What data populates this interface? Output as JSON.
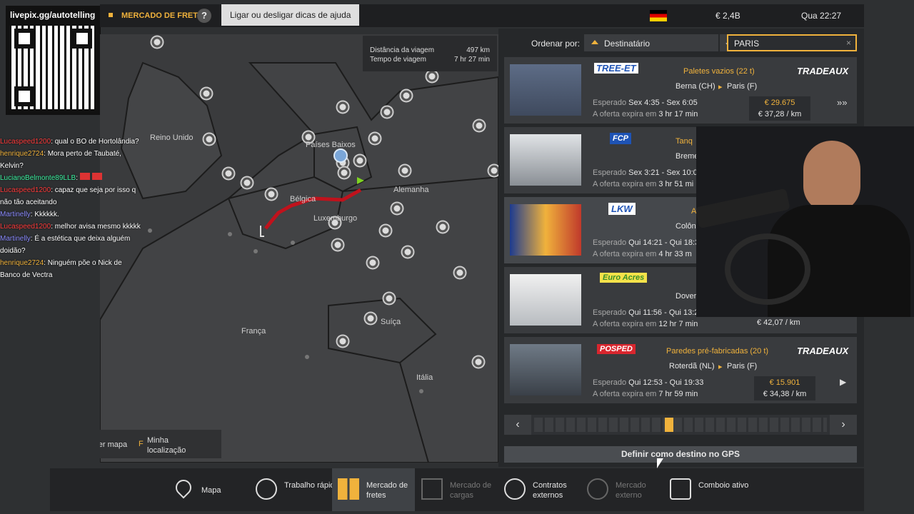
{
  "stream": {
    "livepix_url": "livepix.gg/autotelling"
  },
  "top": {
    "breadcrumb": "MERCADO DE FRETES",
    "help": "?",
    "tooltip": "Ligar ou desligar dicas de ajuda",
    "money": "€ 2,4B",
    "time": "Qua 22:27",
    "flag_colors": [
      "#000000",
      "#dd0000",
      "#ffce00"
    ]
  },
  "map": {
    "info": {
      "distance_label": "Distância da viagem",
      "distance_value": "497 km",
      "time_label": "Tempo de viagem",
      "time_value": "7 hr 27 min"
    },
    "countries": [
      "Reino Unido",
      "Países Baixos",
      "Bélgica",
      "Alemanha",
      "Luxemburgo",
      "França",
      "Suíça",
      "Itália"
    ],
    "controls": {
      "move_map": "Mover mapa",
      "my_location_key": "F",
      "my_location": "Minha localização"
    },
    "route_color": "#c0121c"
  },
  "panel": {
    "sort_label": "Ordenar por:",
    "sort_value": "Destinatário",
    "search_value": "PARIS",
    "jobs": [
      {
        "company": "TREE-ET",
        "cargo": "Paletes vazios (22 t)",
        "origin": "Berna (CH)",
        "dest": "Paris (F)",
        "expected_label": "Esperado",
        "expected": "Sex 4:35 - Sex 6:05",
        "expires_label": "A oferta expira em",
        "expires": "3 hr 17 min",
        "price": "€ 29.675",
        "per_km": "€ 37,28 / km",
        "client": "TRADEAUX"
      },
      {
        "company": "FCP",
        "cargo": "Tanq",
        "origin": "Breme",
        "dest": "",
        "expected_label": "Esperado",
        "expected": "Sex 3:21 - Sex 10:0",
        "expires_label": "A oferta expira em",
        "expires": "3 hr 51 mi",
        "price": "",
        "per_km": "",
        "client": ""
      },
      {
        "company": "LKW",
        "cargo": "A",
        "origin": "Colôn",
        "dest": "",
        "expected_label": "Esperado",
        "expected": "Qui 14:21 - Qui 18:3",
        "expires_label": "A oferta expira em",
        "expires": "4 hr 33 m",
        "price": "",
        "per_km": "",
        "client": ""
      },
      {
        "company": "Euro Acres",
        "cargo": "",
        "origin": "Dover",
        "dest": "",
        "expected_label": "Esperado",
        "expected": "Qui 11:56 - Qui 13:2",
        "expires_label": "A oferta expira em",
        "expires": "12 hr 7 min",
        "price": "",
        "per_km": "€ 42,07 / km",
        "client": ""
      },
      {
        "company": "POSPED",
        "cargo": "Paredes pré-fabricadas (20 t)",
        "origin": "Roterdã (NL)",
        "dest": "Paris (F)",
        "expected_label": "Esperado",
        "expected": "Qui 12:53 - Qui 19:33",
        "expires_label": "A oferta expira em",
        "expires": "7 hr 59 min",
        "price": "€ 15.901",
        "per_km": "€ 34,38 / km",
        "client": "TRADEAUX"
      }
    ],
    "gps_button": "Definir como destino no GPS"
  },
  "chat": [
    {
      "user": "Lucaspeed1200",
      "color": "#ff3c3c",
      "text": ": qual o BO de Hortolândia?"
    },
    {
      "user": "henrique2724",
      "color": "#f0b23c",
      "text": ": Mora perto de Taubaté, Kelvin?"
    },
    {
      "user": "LucianoBelmonte89LLB",
      "color": "#3cf0a0",
      "text": ":"
    },
    {
      "user": "Lucaspeed1200",
      "color": "#ff3c3c",
      "text": ": capaz que seja por isso q não tão aceitando"
    },
    {
      "user": "Martinelly",
      "color": "#8c8cff",
      "text": ": Kkkkkk."
    },
    {
      "user": "Lucaspeed1200",
      "color": "#ff3c3c",
      "text": ": melhor avisa mesmo kkkkk"
    },
    {
      "user": "Martinelly",
      "color": "#8c8cff",
      "text": ": É a estética que deixa alguém doidão?"
    },
    {
      "user": "henrique2724",
      "color": "#f0b23c",
      "text": ": Ninguém põe o Nick de Banco de Vectra"
    }
  ],
  "nav": [
    {
      "label": "Mapa",
      "icon": "map-icon",
      "state": "normal"
    },
    {
      "label": "Trabalho rápido",
      "icon": "clock-icon",
      "state": "normal"
    },
    {
      "label": "Mercado de fretes",
      "icon": "freight-icon",
      "state": "active"
    },
    {
      "label": "Mercado de cargas",
      "icon": "cargo-icon",
      "state": "dim"
    },
    {
      "label": "Contratos externos",
      "icon": "globe-icon",
      "state": "normal"
    },
    {
      "label": "Mercado externo",
      "icon": "globe-truck-icon",
      "state": "dim"
    },
    {
      "label": "Comboio ativo",
      "icon": "convoy-icon",
      "state": "normal"
    }
  ],
  "colors": {
    "accent": "#f0b23c",
    "panel": "#26282a",
    "row": "#393b3e"
  }
}
